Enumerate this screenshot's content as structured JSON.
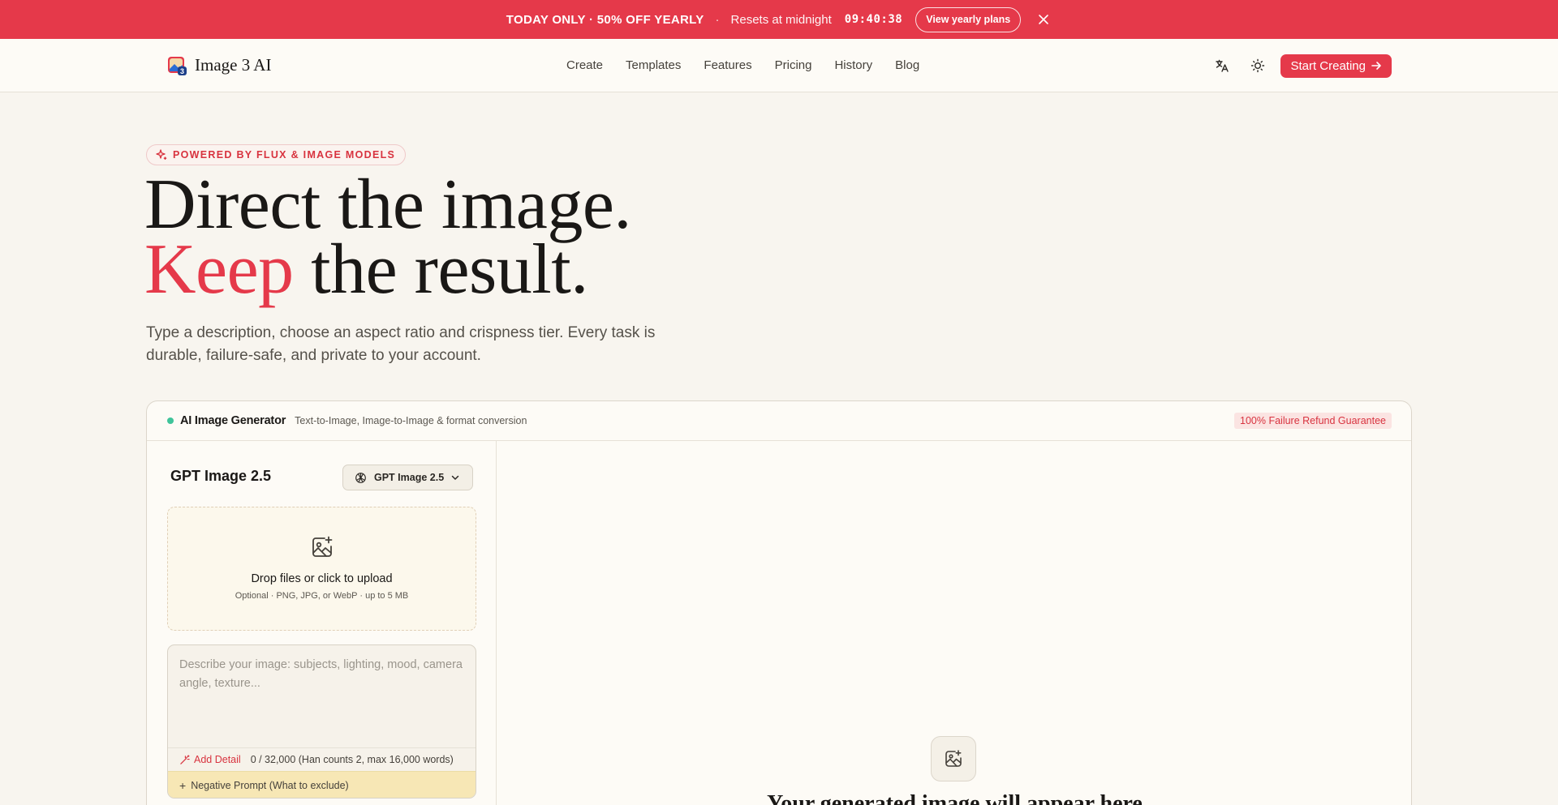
{
  "promo": {
    "headline": "TODAY ONLY · 50% OFF YEARLY",
    "separator": "·",
    "resets": "Resets at midnight",
    "timer": "09:40:38",
    "cta": "View yearly plans"
  },
  "nav": {
    "brand": "Image 3 AI",
    "links": [
      "Create",
      "Templates",
      "Features",
      "Pricing",
      "History",
      "Blog"
    ],
    "cta": "Start Creating"
  },
  "hero": {
    "badge": "POWERED BY FLUX & IMAGE MODELS",
    "title_line1": "Direct the image.",
    "title_accent": "Keep",
    "title_line2_rest": " the result.",
    "subtitle": "Type a description, choose an aspect ratio and crispness tier. Every task is durable, failure-safe, and private to your account."
  },
  "generator": {
    "title": "AI Image Generator",
    "description": "Text-to-Image, Image-to-Image & format conversion",
    "guarantee": "100% Failure Refund Guarantee",
    "model_name": "GPT Image 2.5",
    "model_select": "GPT Image 2.5",
    "upload_title": "Drop files or click to upload",
    "upload_hint": "Optional · PNG, JPG, or WebP · up to 5 MB",
    "prompt_placeholder": "Describe your image: subjects, lighting, mood, camera angle, texture...",
    "add_detail": "Add Detail",
    "counter": "0 / 32,000 (Han counts 2, max 16,000 words)",
    "negative_prompt": "Negative Prompt (What to exclude)",
    "preview_text": "Your generated image will appear here"
  },
  "colors": {
    "accent": "#e5394a",
    "background": "#f8f5ef",
    "status_dot": "#3fc49a",
    "negative_bg": "#f7e7b5"
  },
  "icons": [
    "close-icon",
    "translate-icon",
    "sun-icon",
    "arrow-right-icon",
    "sparkle-icon",
    "openai-icon",
    "chevron-down-icon",
    "image-plus-icon",
    "magic-wand-icon",
    "plus-icon"
  ]
}
